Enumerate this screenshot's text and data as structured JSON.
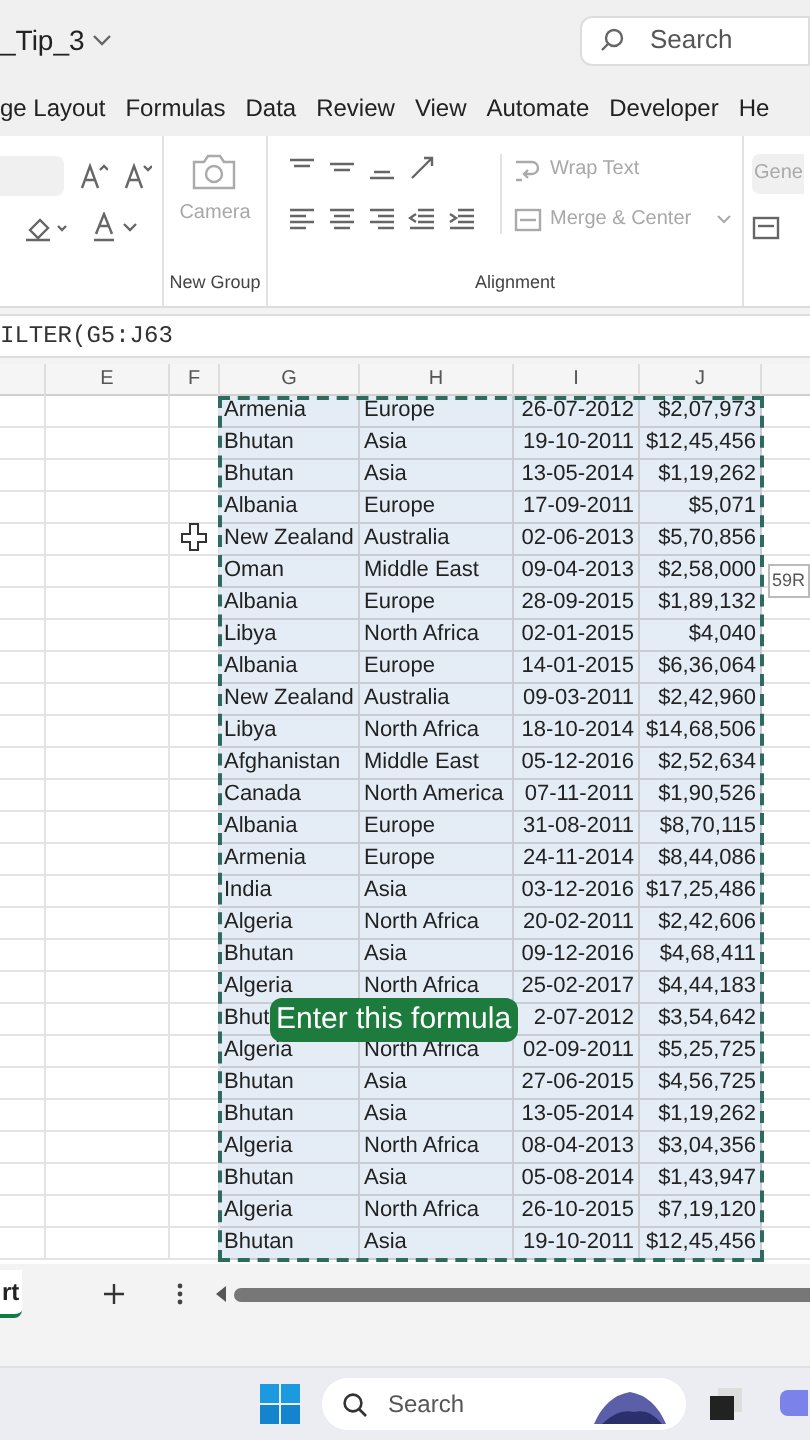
{
  "window": {
    "title": "_Tip_3"
  },
  "search": {
    "placeholder": "Search"
  },
  "ribbon_tabs": [
    {
      "label": "ge Layout"
    },
    {
      "label": "Formulas"
    },
    {
      "label": "Data"
    },
    {
      "label": "Review"
    },
    {
      "label": "View"
    },
    {
      "label": "Automate"
    },
    {
      "label": "Developer"
    },
    {
      "label": "He"
    }
  ],
  "ribbon": {
    "camera": {
      "label": "Camera",
      "disabled": true
    },
    "wrap_text": {
      "label": "Wrap Text",
      "disabled": true
    },
    "merge_center": {
      "label": "Merge & Center",
      "disabled": true
    },
    "number_format": "Gene",
    "group_labels": [
      "New Group",
      "Alignment"
    ]
  },
  "formula_bar": {
    "value": "ILTER(G5:J63"
  },
  "columns": [
    "E",
    "F",
    "G",
    "H",
    "I",
    "J"
  ],
  "rows": [
    {
      "country": "Armenia",
      "region": "Europe",
      "date": "26-07-2012",
      "amount": "$2,07,973"
    },
    {
      "country": "Bhutan",
      "region": "Asia",
      "date": "19-10-2011",
      "amount": "$12,45,456"
    },
    {
      "country": "Bhutan",
      "region": "Asia",
      "date": "13-05-2014",
      "amount": "$1,19,262"
    },
    {
      "country": "Albania",
      "region": "Europe",
      "date": "17-09-2011",
      "amount": "$5,071"
    },
    {
      "country": "New Zealand",
      "region": "Australia",
      "date": "02-06-2013",
      "amount": "$5,70,856"
    },
    {
      "country": "Oman",
      "region": "Middle East",
      "date": "09-04-2013",
      "amount": "$2,58,000"
    },
    {
      "country": "Albania",
      "region": "Europe",
      "date": "28-09-2015",
      "amount": "$1,89,132"
    },
    {
      "country": "Libya",
      "region": "North Africa",
      "date": "02-01-2015",
      "amount": "$4,040"
    },
    {
      "country": "Albania",
      "region": "Europe",
      "date": "14-01-2015",
      "amount": "$6,36,064"
    },
    {
      "country": "New Zealand",
      "region": "Australia",
      "date": "09-03-2011",
      "amount": "$2,42,960"
    },
    {
      "country": "Libya",
      "region": "North Africa",
      "date": "18-10-2014",
      "amount": "$14,68,506"
    },
    {
      "country": "Afghanistan",
      "region": "Middle East",
      "date": "05-12-2016",
      "amount": "$2,52,634"
    },
    {
      "country": "Canada",
      "region": "North America",
      "date": "07-11-2011",
      "amount": "$1,90,526"
    },
    {
      "country": "Albania",
      "region": "Europe",
      "date": "31-08-2011",
      "amount": "$8,70,115"
    },
    {
      "country": "Armenia",
      "region": "Europe",
      "date": "24-11-2014",
      "amount": "$8,44,086"
    },
    {
      "country": "India",
      "region": "Asia",
      "date": "03-12-2016",
      "amount": "$17,25,486"
    },
    {
      "country": "Algeria",
      "region": "North Africa",
      "date": "20-02-2011",
      "amount": "$2,42,606"
    },
    {
      "country": "Bhutan",
      "region": "Asia",
      "date": "09-12-2016",
      "amount": "$4,68,411"
    },
    {
      "country": "Algeria",
      "region": "North Africa",
      "date": "25-02-2017",
      "amount": "$4,44,183"
    },
    {
      "country": "Bhut",
      "date": "2-07-2012",
      "amount": "$3,54,642"
    },
    {
      "country": "Algeria",
      "region": "North Africa",
      "date": "02-09-2011",
      "amount": "$5,25,725"
    },
    {
      "country": "Bhutan",
      "region": "Asia",
      "date": "27-06-2015",
      "amount": "$4,56,725"
    },
    {
      "country": "Bhutan",
      "region": "Asia",
      "date": "13-05-2014",
      "amount": "$1,19,262"
    },
    {
      "country": "Algeria",
      "region": "North Africa",
      "date": "08-04-2013",
      "amount": "$3,04,356"
    },
    {
      "country": "Bhutan",
      "region": "Asia",
      "date": "05-08-2014",
      "amount": "$1,43,947"
    },
    {
      "country": "Algeria",
      "region": "North Africa",
      "date": "26-10-2015",
      "amount": "$7,19,120"
    },
    {
      "country": "Bhutan",
      "region": "Asia",
      "date": "19-10-2011",
      "amount": "$12,45,456"
    }
  ],
  "caption": "Enter this formula",
  "tooltip": "59R",
  "sheet_tabs": [
    {
      "label": "rt",
      "selected": true
    }
  ],
  "taskbar": {
    "search_placeholder": "Search"
  }
}
